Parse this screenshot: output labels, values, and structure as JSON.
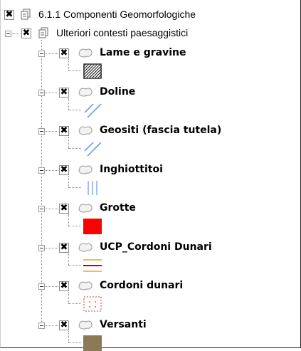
{
  "tree": {
    "root": {
      "label": "6.1.1 Componenti Geomorfologiche",
      "checked": true,
      "checkmark": "✖",
      "icon": "group-folder-icon"
    },
    "group": {
      "label": "Ulteriori contesti paesaggistici",
      "checked": true,
      "checkmark": "✖",
      "expanded": true,
      "icon": "group-folder-icon"
    },
    "layers": [
      {
        "label": "Lame e gravine",
        "checkmark": "✖",
        "symbol": "diagonal-hatch-icon",
        "colors": {
          "stroke": "#333333",
          "fill": "#ffffff"
        }
      },
      {
        "label": "Doline",
        "checkmark": "✖",
        "symbol": "blue-diagonal-lines-icon",
        "colors": {
          "stroke": "#5b8fe0"
        }
      },
      {
        "label": "Geositi (fascia tutela)",
        "checkmark": "✖",
        "symbol": "blue-diagonal-lines-icon",
        "colors": {
          "stroke": "#5b8fe0"
        }
      },
      {
        "label": "Inghiottitoi",
        "checkmark": "✖",
        "symbol": "blue-vertical-lines-icon",
        "colors": {
          "stroke": "#8aa6f0"
        }
      },
      {
        "label": "Grotte",
        "checkmark": "✖",
        "symbol": "red-fill-icon",
        "colors": {
          "fill": "#ff0000"
        }
      },
      {
        "label": "UCP_Cordoni Dunari",
        "checkmark": "✖",
        "symbol": "red-orange-lines-icon",
        "colors": {
          "top": "#f0a030",
          "middle": "#cc0000",
          "bottom": "#f0a030"
        }
      },
      {
        "label": "Cordoni dunari",
        "checkmark": "✖",
        "symbol": "red-dotted-box-icon",
        "colors": {
          "stroke": "#e03030"
        }
      },
      {
        "label": "Versanti",
        "checkmark": "✖",
        "symbol": "brown-fill-icon",
        "colors": {
          "fill": "#8b7a55"
        }
      }
    ]
  }
}
